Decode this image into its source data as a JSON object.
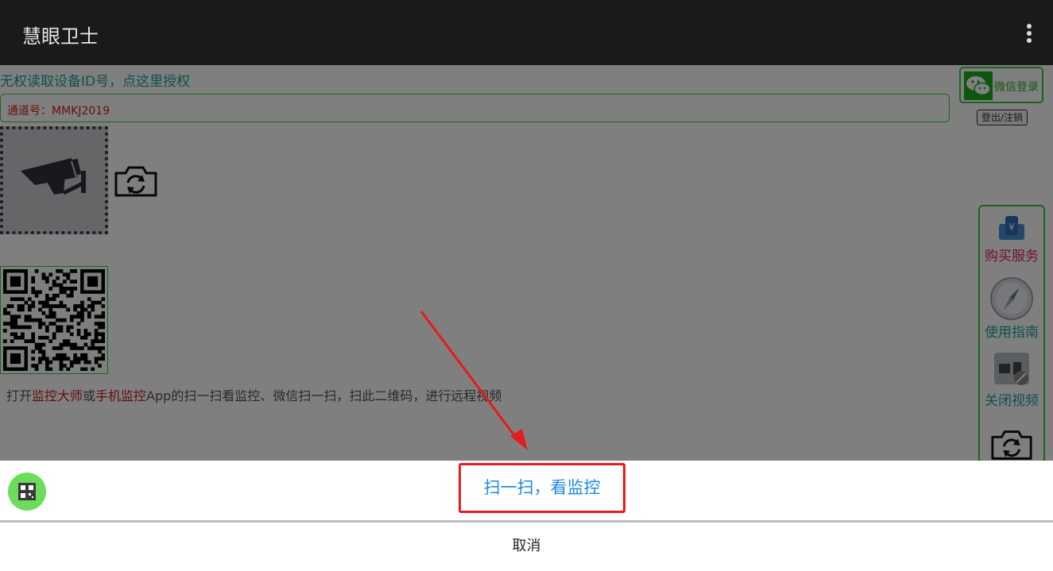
{
  "app_bar": {
    "title": "慧眼卫士"
  },
  "content": {
    "auth_link": "无权读取设备ID号，点这里授权",
    "channel_label": "通道号：MMKJ2019",
    "hint": {
      "part1": "打开",
      "app1": "监控大师",
      "part2": "或",
      "app2": "手机监控",
      "part3": "App的扫一扫看监控、微信扫一扫，扫此二维码，进行远程视频"
    }
  },
  "wechat": {
    "login_label": "微信登录",
    "logout_label": "登出/注销"
  },
  "side_menu": {
    "items": [
      {
        "label": "购买服务",
        "color": "#e0245e"
      },
      {
        "label": "使用指南",
        "color": "#1aa59a"
      },
      {
        "label": "关闭视频",
        "color": "#1aa59a"
      }
    ]
  },
  "bottom_sheet": {
    "scan_label": "扫一扫，看监控",
    "cancel_label": "取消"
  },
  "colors": {
    "accent_green": "#38c838",
    "highlight_red": "#e51c1c",
    "link_blue": "#1e87e5"
  }
}
